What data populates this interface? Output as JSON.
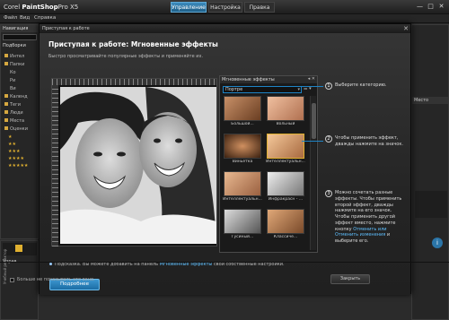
{
  "app": {
    "title_prefix": "Corel",
    "title_main": "PaintShop",
    "title_suffix": "Pro X5",
    "workspace_tabs": [
      {
        "label": "Управление",
        "active": true
      },
      {
        "label": "Настройка",
        "active": false
      },
      {
        "label": "Правка",
        "active": false
      }
    ],
    "window_controls": [
      "—",
      "□",
      "✕"
    ]
  },
  "menubar": {
    "items": [
      "Файл",
      "Вид",
      "Справка"
    ]
  },
  "background": {
    "nav_label": "Навигация",
    "sidebar_tab": "Подборки",
    "tree_items": [
      "Интел",
      "Папки",
      "Ко",
      "Ри",
      "Ви",
      "Календ",
      "Теги",
      "Люди",
      "Места",
      "Оценки",
      "★",
      "★★",
      "★★★",
      "★★★★",
      "★★★★★"
    ],
    "right_tabs": [
      "Место"
    ],
    "bottom_tab": "Управ",
    "side_label": "Учебный редактор"
  },
  "dialog": {
    "window_title": "Приступая к работе",
    "heading": "Приступая к работе: Мгновенные эффекты",
    "subtitle": "Быстро просматривайте популярные эффекты и применяйте их.",
    "panel": {
      "title": "Мгновенные эффекты",
      "controls": "◂ ✕",
      "category": "Портре",
      "tools": "☰ ▾",
      "thumbnails": [
        {
          "label": "Большой...",
          "selected": false
        },
        {
          "label": "Вольный",
          "selected": false
        },
        {
          "label": "Виньетка",
          "selected": false
        },
        {
          "label": "Интеллектуальн...",
          "selected": true
        },
        {
          "label": "Интеллектуальн...",
          "selected": false
        },
        {
          "label": "Инфракрасн - ...",
          "selected": false
        },
        {
          "label": "Гусиный...",
          "selected": false
        },
        {
          "label": "Классиче...",
          "selected": false
        }
      ]
    },
    "callouts": [
      {
        "num": "1",
        "text": "Выберите категорию."
      },
      {
        "num": "2",
        "text": "Чтобы применить эффект, дважды нажмите на значок."
      },
      {
        "num": "3",
        "text_a": "Можно сочетать разные эффекты. Чтобы применить второй эффект, дважды нажмите на его значок. Чтобы применить другой эффект вместо, нажмите кнопку",
        "link": "Отменить или",
        "link2": "Отменить изменения",
        "text_b": "и выберите его."
      }
    ],
    "tip": {
      "text": "Подсказка. Вы можете добавить на панель",
      "link": "Мгновенные эффекты",
      "tail": "свои собственные настройки."
    },
    "more_button": "Подробнее",
    "dont_show_label": "Больше не показывать это окно.",
    "close_button": "Закрыть"
  },
  "colors": {
    "accent": "#1e84c6",
    "link": "#5fc0ff",
    "selection": "#e0b030"
  }
}
